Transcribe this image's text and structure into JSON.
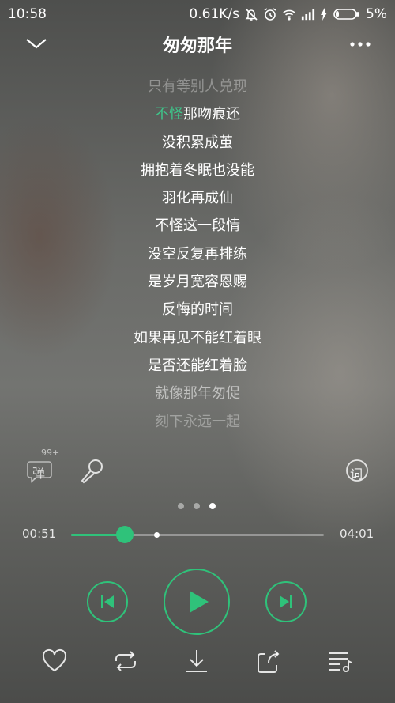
{
  "status": {
    "time": "10:58",
    "speed": "0.61K/s",
    "battery": "5%",
    "icons": [
      "mute-icon",
      "alarm-icon",
      "wifi-icon",
      "signal-icon",
      "charging-icon",
      "battery-icon"
    ]
  },
  "header": {
    "title": "匆匆那年",
    "back_icon": "chevron-down-icon",
    "more_icon": "more-icon"
  },
  "lyrics": {
    "line0": "只有等别人兑现",
    "line1_highlight": "不怪",
    "line1_rest": "那吻痕还",
    "line2": "没积累成茧",
    "line3": "拥抱着冬眠也没能",
    "line4": "羽化再成仙",
    "line5": "不怪这一段情",
    "line6": "没空反复再排练",
    "line7": "是岁月宽容恩赐",
    "line8": "反悔的时间",
    "line9": "如果再见不能红着眼",
    "line10": "是否还能红着脸",
    "line11": "就像那年匆促",
    "line12": "刻下永远一起"
  },
  "tools": {
    "danmaku_badge": "99+",
    "danmaku_label": "弹",
    "lyric_label": "词"
  },
  "pager": {
    "count": 3,
    "active": 3
  },
  "player": {
    "current_time": "00:51",
    "total_time": "04:01",
    "progress": 0.2116,
    "buffered": 0.336,
    "accent": "#2fc27a"
  },
  "bottom_bar": [
    "heart-icon",
    "repeat-icon",
    "download-icon",
    "share-icon",
    "playlist-icon"
  ]
}
